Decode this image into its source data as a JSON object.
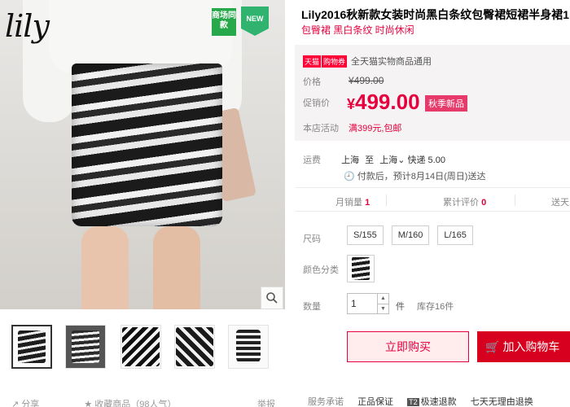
{
  "gallery": {
    "brand": "lily",
    "badge_left": "商场同款",
    "badge_right": "NEW",
    "zoom_icon": "search-icon"
  },
  "product": {
    "title": "Lily2016秋新款女装时尚黑白条纹包臀裙短裙半身裙1",
    "subtitle": "包臀裙 黑白条纹 时尚休闲"
  },
  "price": {
    "tmall_tag": "天猫",
    "real_tag": "购物券",
    "tmall_text": "全天猫实物商品通用",
    "price_label": "价格",
    "old_price": "¥499.00",
    "promo_label": "促销价",
    "promo_currency": "¥",
    "promo_value": "499.00",
    "season_tag": "秋季新品",
    "store_label": "本店活动",
    "store_promo": "满399元,包邮"
  },
  "shipping": {
    "label": "运费",
    "from": "上海",
    "to_word": "至",
    "dest": "上海",
    "method": "快递 5.00",
    "note": "付款后，预计8月14日(周日)送达"
  },
  "stats": {
    "monthly_label": "月销量",
    "monthly_value": "1",
    "review_label": "累计评价",
    "review_value": "0",
    "gift_label": "送天"
  },
  "options": {
    "size_label": "尺码",
    "sizes": [
      "S/155",
      "M/160",
      "L/165"
    ],
    "color_label": "颜色分类",
    "qty_label": "数量",
    "qty_value": "1",
    "qty_unit": "件",
    "stock": "库存16件"
  },
  "actions": {
    "buy_now": "立即购买",
    "add_cart": "加入购物车"
  },
  "footer": {
    "share": "分享",
    "favorite": "收藏商品（98人气）",
    "report": "举报",
    "service_label": "服务承诺",
    "services": [
      "正品保证",
      "极速退款",
      "七天无理由退换"
    ],
    "t2_tag": "T2"
  }
}
